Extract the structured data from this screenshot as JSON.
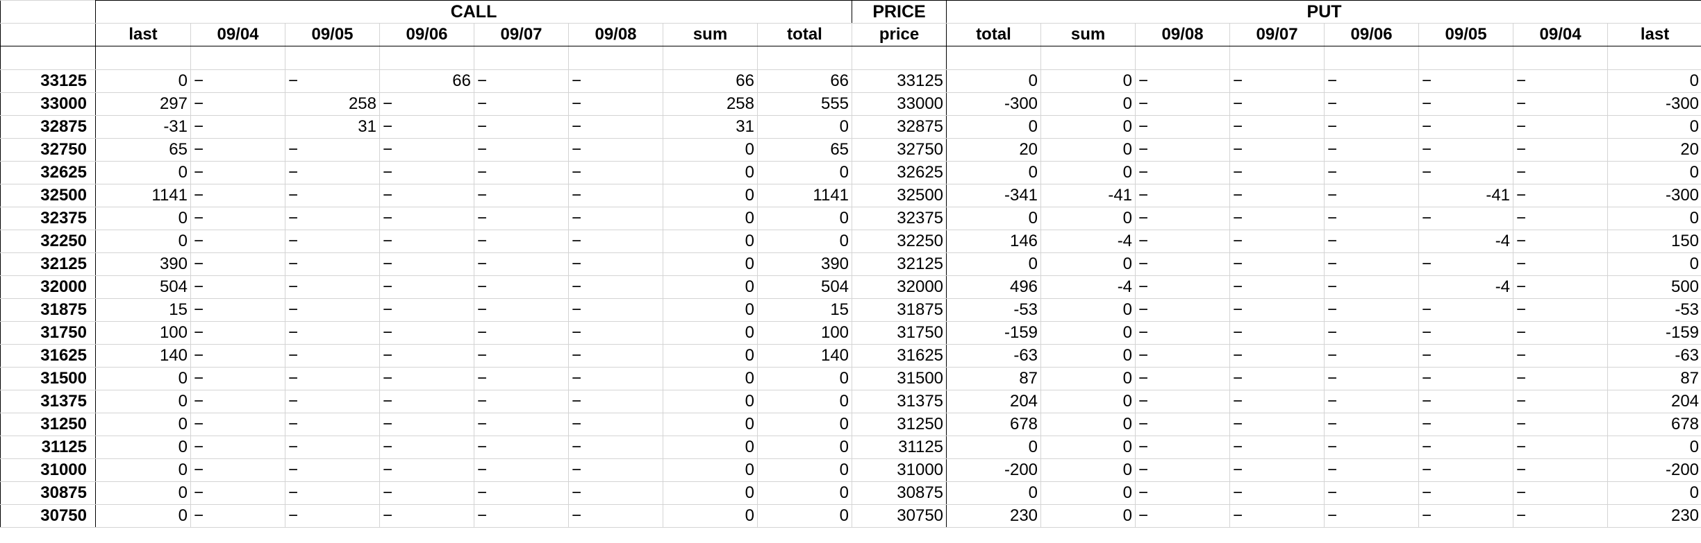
{
  "groups": {
    "call": "CALL",
    "price": "PRICE",
    "put": "PUT"
  },
  "columns": [
    "last",
    "09/04",
    "09/05",
    "09/06",
    "09/07",
    "09/08",
    "sum",
    "total",
    "price",
    "total",
    "sum",
    "09/08",
    "09/07",
    "09/06",
    "09/05",
    "09/04",
    "last"
  ],
  "dash": "−",
  "rows": [
    {
      "strike": "33125",
      "cells": [
        "0",
        "−",
        "−",
        "66",
        "−",
        "−",
        "66",
        "66",
        "33125",
        "0",
        "0",
        "−",
        "−",
        "−",
        "−",
        "−",
        "0"
      ]
    },
    {
      "strike": "33000",
      "cells": [
        "297",
        "−",
        "258",
        "−",
        "−",
        "−",
        "258",
        "555",
        "33000",
        "-300",
        "0",
        "−",
        "−",
        "−",
        "−",
        "−",
        "-300"
      ]
    },
    {
      "strike": "32875",
      "cells": [
        "-31",
        "−",
        "31",
        "−",
        "−",
        "−",
        "31",
        "0",
        "32875",
        "0",
        "0",
        "−",
        "−",
        "−",
        "−",
        "−",
        "0"
      ]
    },
    {
      "strike": "32750",
      "cells": [
        "65",
        "−",
        "−",
        "−",
        "−",
        "−",
        "0",
        "65",
        "32750",
        "20",
        "0",
        "−",
        "−",
        "−",
        "−",
        "−",
        "20"
      ]
    },
    {
      "strike": "32625",
      "cells": [
        "0",
        "−",
        "−",
        "−",
        "−",
        "−",
        "0",
        "0",
        "32625",
        "0",
        "0",
        "−",
        "−",
        "−",
        "−",
        "−",
        "0"
      ]
    },
    {
      "strike": "32500",
      "cells": [
        "1141",
        "−",
        "−",
        "−",
        "−",
        "−",
        "0",
        "1141",
        "32500",
        "-341",
        "-41",
        "−",
        "−",
        "−",
        "-41",
        "−",
        "-300"
      ]
    },
    {
      "strike": "32375",
      "cells": [
        "0",
        "−",
        "−",
        "−",
        "−",
        "−",
        "0",
        "0",
        "32375",
        "0",
        "0",
        "−",
        "−",
        "−",
        "−",
        "−",
        "0"
      ]
    },
    {
      "strike": "32250",
      "cells": [
        "0",
        "−",
        "−",
        "−",
        "−",
        "−",
        "0",
        "0",
        "32250",
        "146",
        "-4",
        "−",
        "−",
        "−",
        "-4",
        "−",
        "150"
      ]
    },
    {
      "strike": "32125",
      "cells": [
        "390",
        "−",
        "−",
        "−",
        "−",
        "−",
        "0",
        "390",
        "32125",
        "0",
        "0",
        "−",
        "−",
        "−",
        "−",
        "−",
        "0"
      ]
    },
    {
      "strike": "32000",
      "cells": [
        "504",
        "−",
        "−",
        "−",
        "−",
        "−",
        "0",
        "504",
        "32000",
        "496",
        "-4",
        "−",
        "−",
        "−",
        "-4",
        "−",
        "500"
      ]
    },
    {
      "strike": "31875",
      "cells": [
        "15",
        "−",
        "−",
        "−",
        "−",
        "−",
        "0",
        "15",
        "31875",
        "-53",
        "0",
        "−",
        "−",
        "−",
        "−",
        "−",
        "-53"
      ]
    },
    {
      "strike": "31750",
      "cells": [
        "100",
        "−",
        "−",
        "−",
        "−",
        "−",
        "0",
        "100",
        "31750",
        "-159",
        "0",
        "−",
        "−",
        "−",
        "−",
        "−",
        "-159"
      ]
    },
    {
      "strike": "31625",
      "cells": [
        "140",
        "−",
        "−",
        "−",
        "−",
        "−",
        "0",
        "140",
        "31625",
        "-63",
        "0",
        "−",
        "−",
        "−",
        "−",
        "−",
        "-63"
      ]
    },
    {
      "strike": "31500",
      "cells": [
        "0",
        "−",
        "−",
        "−",
        "−",
        "−",
        "0",
        "0",
        "31500",
        "87",
        "0",
        "−",
        "−",
        "−",
        "−",
        "−",
        "87"
      ]
    },
    {
      "strike": "31375",
      "cells": [
        "0",
        "−",
        "−",
        "−",
        "−",
        "−",
        "0",
        "0",
        "31375",
        "204",
        "0",
        "−",
        "−",
        "−",
        "−",
        "−",
        "204"
      ]
    },
    {
      "strike": "31250",
      "cells": [
        "0",
        "−",
        "−",
        "−",
        "−",
        "−",
        "0",
        "0",
        "31250",
        "678",
        "0",
        "−",
        "−",
        "−",
        "−",
        "−",
        "678"
      ]
    },
    {
      "strike": "31125",
      "cells": [
        "0",
        "−",
        "−",
        "−",
        "−",
        "−",
        "0",
        "0",
        "31125",
        "0",
        "0",
        "−",
        "−",
        "−",
        "−",
        "−",
        "0"
      ]
    },
    {
      "strike": "31000",
      "cells": [
        "0",
        "−",
        "−",
        "−",
        "−",
        "−",
        "0",
        "0",
        "31000",
        "-200",
        "0",
        "−",
        "−",
        "−",
        "−",
        "−",
        "-200"
      ]
    },
    {
      "strike": "30875",
      "cells": [
        "0",
        "−",
        "−",
        "−",
        "−",
        "−",
        "0",
        "0",
        "30875",
        "0",
        "0",
        "−",
        "−",
        "−",
        "−",
        "−",
        "0"
      ]
    },
    {
      "strike": "30750",
      "cells": [
        "0",
        "−",
        "−",
        "−",
        "−",
        "−",
        "0",
        "0",
        "30750",
        "230",
        "0",
        "−",
        "−",
        "−",
        "−",
        "−",
        "230"
      ]
    }
  ]
}
